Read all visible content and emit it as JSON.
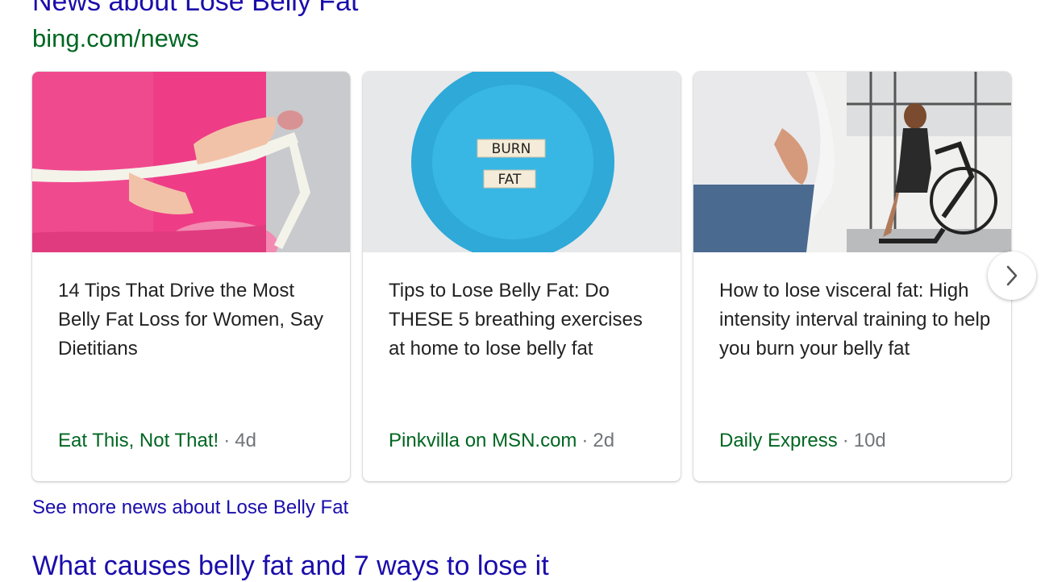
{
  "section": {
    "title": "News about Lose Belly Fat",
    "source": "bing.com/news"
  },
  "cards": [
    {
      "image": "tape-measure-waist-photo",
      "headline": "14 Tips That Drive the Most Belly Fat Loss for Women, Say Dietitians",
      "publisher": "Eat This, Not That!",
      "separator": "·",
      "age": "4d"
    },
    {
      "image": "burn-fat-plate-photo",
      "image_text": [
        "BURN",
        "FAT"
      ],
      "headline": "Tips to Lose Belly Fat: Do THESE 5 breathing exercises at home to lose belly fat",
      "publisher": "Pinkvilla on MSN.com",
      "separator": "·",
      "age": "2d"
    },
    {
      "image": "belly-and-gym-bike-photo",
      "headline": "How to lose visceral fat: High intensity interval training to help you burn your belly fat",
      "publisher": "Daily Express",
      "separator": "·",
      "age": "10d"
    }
  ],
  "carousel": {
    "next_icon": "chevron-right-icon"
  },
  "see_more": "See more news about Lose Belly Fat",
  "next_result_title": "What causes belly fat and 7 ways to lose it",
  "colors": {
    "link": "#1a0dab",
    "source": "#006621",
    "meta": "#70757a"
  }
}
